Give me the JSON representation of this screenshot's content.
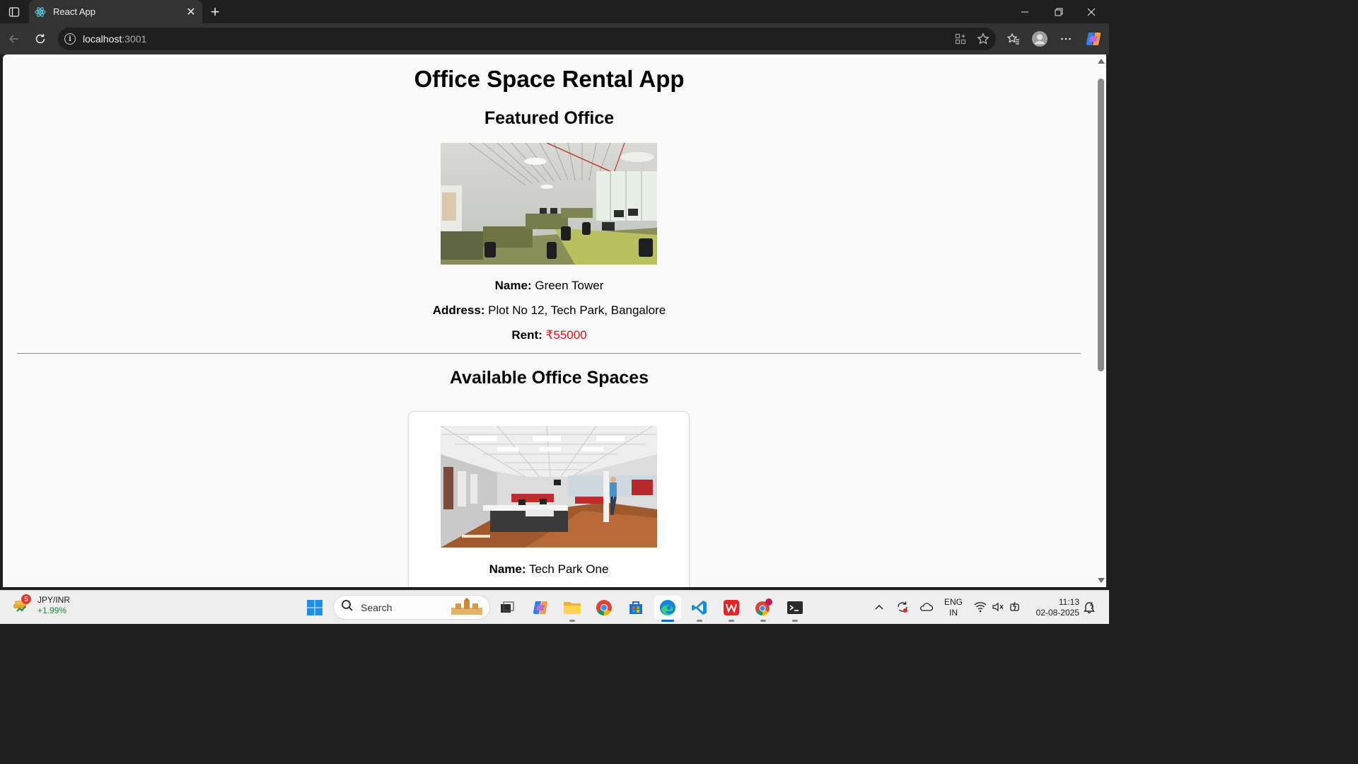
{
  "browser": {
    "tab_title": "React App",
    "url_host": "localhost",
    "url_port": ":3001"
  },
  "page": {
    "app_title": "Office Space Rental App",
    "featured_heading": "Featured Office",
    "featured": {
      "name_label": "Name:",
      "name": "Green Tower",
      "address_label": "Address:",
      "address": "Plot No 12, Tech Park, Bangalore",
      "rent_label": "Rent:",
      "rent": "₹55000",
      "rent_color": "#e8121a"
    },
    "available_heading": "Available Office Spaces",
    "listings": [
      {
        "name_label": "Name:",
        "name": "Tech Park One"
      }
    ]
  },
  "taskbar": {
    "widget_badge": "5",
    "widget_title": "JPY/INR",
    "widget_change": "+1.99%",
    "search_label": "Search",
    "lang_line1": "ENG",
    "lang_line2": "IN",
    "time": "11:13",
    "date": "02-08-2025",
    "apps": [
      "start-icon",
      "search",
      "task-view-icon",
      "copilot-icon",
      "file-explorer-icon",
      "chrome-icon",
      "microsoft-store-icon",
      "edge-icon",
      "vscode-icon",
      "wps-office-icon",
      "chrome-profile-icon",
      "terminal-icon"
    ]
  }
}
